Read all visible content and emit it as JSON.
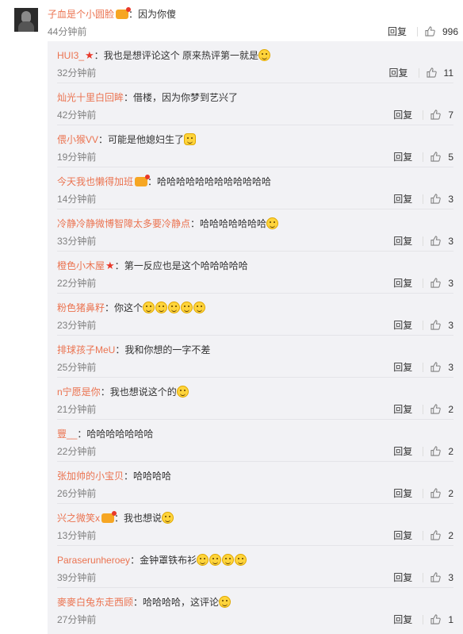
{
  "top": {
    "user": "子血是个小圆脸",
    "text": "因为你傻",
    "time": "44分钟前",
    "reply": "回复",
    "likes": "996"
  },
  "replies": [
    {
      "user": "HUI3_",
      "badge": "star",
      "text": "我也是想评论这个 原来热评第一就是",
      "emoji": [
        "smile"
      ],
      "time": "32分钟前",
      "reply": "回复",
      "likes": "11"
    },
    {
      "user": "灿光十里白回眸",
      "badge": "",
      "text": "借楼，因为你梦到艺兴了",
      "emoji": [],
      "time": "42分钟前",
      "reply": "回复",
      "likes": "7"
    },
    {
      "user": "偎小猴VV",
      "badge": "",
      "text": "可能是他媳妇生了",
      "emoji": [
        "cat"
      ],
      "time": "19分钟前",
      "reply": "回复",
      "likes": "5"
    },
    {
      "user": "今天我也懒得加班",
      "badge": "vip",
      "text": "哈哈哈哈哈哈哈哈哈哈哈哈",
      "emoji": [],
      "time": "14分钟前",
      "reply": "回复",
      "likes": "3"
    },
    {
      "user": "冷静冷静微博智障太多要冷静点",
      "badge": "",
      "text": "哈哈哈哈哈哈哈",
      "emoji": [
        "laugh"
      ],
      "time": "33分钟前",
      "reply": "回复",
      "likes": "3"
    },
    {
      "user": "橙色小木屋",
      "badge": "star",
      "text": "第一反应也是这个哈哈哈哈哈",
      "emoji": [],
      "time": "22分钟前",
      "reply": "回复",
      "likes": "3"
    },
    {
      "user": "粉色猪鼻籽",
      "badge": "",
      "text": "你这个",
      "emoji": [
        "laugh",
        "laugh",
        "laugh",
        "laugh",
        "laugh"
      ],
      "time": "23分钟前",
      "reply": "回复",
      "likes": "3"
    },
    {
      "user": "排球孩子MeU",
      "badge": "",
      "text": "我和你想的一字不差",
      "emoji": [],
      "time": "25分钟前",
      "reply": "回复",
      "likes": "3"
    },
    {
      "user": "n宁愿是你",
      "badge": "",
      "text": "我也想说这个的",
      "emoji": [
        "laugh"
      ],
      "time": "21分钟前",
      "reply": "回复",
      "likes": "2"
    },
    {
      "user": "豐__",
      "badge": "",
      "text": "哈哈哈哈哈哈哈",
      "emoji": [],
      "time": "22分钟前",
      "reply": "回复",
      "likes": "2"
    },
    {
      "user": "张加帅的小宝贝",
      "badge": "",
      "text": "哈哈哈哈",
      "emoji": [],
      "time": "26分钟前",
      "reply": "回复",
      "likes": "2"
    },
    {
      "user": "兴之微笑x",
      "badge": "vip",
      "text": "我也想说",
      "emoji": [
        "doge"
      ],
      "time": "13分钟前",
      "reply": "回复",
      "likes": "2"
    },
    {
      "user": "Paraserunheroey",
      "badge": "",
      "text": "金钟罩铁布衫",
      "emoji": [
        "laugh",
        "laugh",
        "laugh",
        "laugh"
      ],
      "time": "39分钟前",
      "reply": "回复",
      "likes": "3"
    },
    {
      "user": "麥麥白兔东走西顾",
      "badge": "",
      "text": "哈哈哈哈，这评论",
      "emoji": [
        "doge"
      ],
      "time": "27分钟前",
      "reply": "回复",
      "likes": "1"
    }
  ]
}
